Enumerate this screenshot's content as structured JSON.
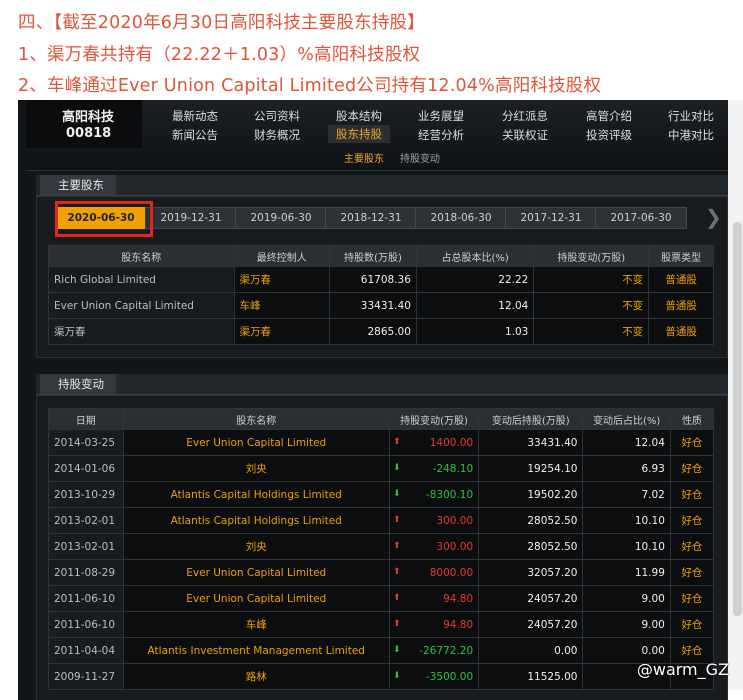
{
  "headlines": [
    "四、【截至2020年6月30日高阳科技主要股东持股】",
    "1、渠万春共持有（22.22＋1.03）%高阳科技股权",
    "2、车峰通过Ever Union Capital Limited公司持有12.04%高阳科技股权"
  ],
  "stock": {
    "name": "高阳科技",
    "code": "00818"
  },
  "nav_top": [
    "最新动态",
    "公司资料",
    "股本结构",
    "业务展望",
    "分红派息",
    "高管介绍",
    "行业对比"
  ],
  "nav_bottom": [
    "新闻公告",
    "财务概况",
    "股东持股",
    "经营分析",
    "关联权证",
    "投资评级",
    "中港对比"
  ],
  "subnav": [
    "主要股东",
    "持股变动"
  ],
  "section1": {
    "title": "主要股东",
    "date_tabs": [
      "2020-06-30",
      "2019-12-31",
      "2019-06-30",
      "2018-12-31",
      "2018-06-30",
      "2017-12-31",
      "2017-06-30"
    ],
    "headers": [
      "股东名称",
      "最终控制人",
      "持股数(万股)",
      "占总股本比(%)",
      "持股变动(万股)",
      "股票类型"
    ],
    "rows": [
      [
        "Rich Global Limited",
        "渠万春",
        "61708.36",
        "22.22",
        "不变",
        "普通股"
      ],
      [
        "Ever Union Capital Limited",
        "车峰",
        "33431.40",
        "12.04",
        "不变",
        "普通股"
      ],
      [
        "渠万春",
        "渠万春",
        "2865.00",
        "1.03",
        "不变",
        "普通股"
      ]
    ]
  },
  "section2": {
    "title": "持股变动",
    "headers": [
      "日期",
      "股东名称",
      "持股变动(万股)",
      "变动后持股(万股)",
      "变动后占比(%)",
      "性质"
    ],
    "rows": [
      [
        "2014-03-25",
        "Ever Union Capital Limited",
        "up",
        "1400.00",
        "33431.40",
        "12.04",
        "好仓"
      ],
      [
        "2014-01-06",
        "刘央",
        "down",
        "-248.10",
        "19254.10",
        "6.93",
        "好仓"
      ],
      [
        "2013-10-29",
        "Atlantis Capital Holdings Limited",
        "down",
        "-8300.10",
        "19502.20",
        "7.02",
        "好仓"
      ],
      [
        "2013-02-01",
        "Atlantis Capital Holdings Limited",
        "up",
        "300.00",
        "28052.50",
        "10.10",
        "好仓"
      ],
      [
        "2013-02-01",
        "刘央",
        "up",
        "300.00",
        "28052.50",
        "10.10",
        "好仓"
      ],
      [
        "2011-08-29",
        "Ever Union Capital Limited",
        "up",
        "8000.00",
        "32057.20",
        "11.99",
        "好仓"
      ],
      [
        "2011-06-10",
        "Ever Union Capital Limited",
        "up",
        "94.80",
        "24057.20",
        "9.00",
        "好仓"
      ],
      [
        "2011-06-10",
        "车峰",
        "up",
        "94.80",
        "24057.20",
        "9.00",
        "好仓"
      ],
      [
        "2011-04-04",
        "Atlantis Investment Management Limited",
        "down",
        "-26772.20",
        "0.00",
        "0.00",
        "好仓"
      ],
      [
        "2009-11-27",
        "路林",
        "down",
        "-3500.00",
        "11525.00",
        "",
        ""
      ]
    ]
  },
  "watermark": "@warm_GZ"
}
